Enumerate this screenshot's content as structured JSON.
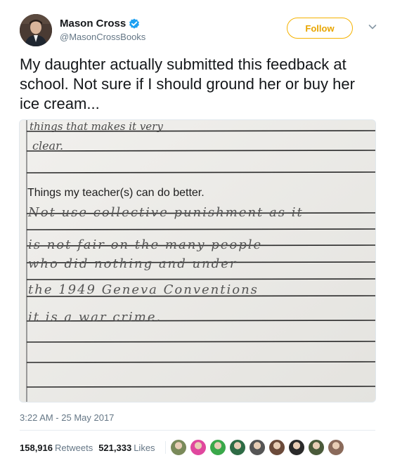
{
  "user": {
    "display_name": "Mason Cross",
    "handle": "@MasonCrossBooks"
  },
  "follow_button": {
    "label": "Follow"
  },
  "tweet": {
    "text": "My daughter actually submitted this feedback at school. Not sure if I should ground her or buy her ice cream...",
    "timestamp": "3:22 AM - 25 May 2017"
  },
  "photo": {
    "top_handwriting_1": "things that makes it very",
    "top_handwriting_2": "clear.",
    "prompt": "Things my teacher(s) can do better.",
    "lines": [
      "Not use collective punishment as it",
      "is not fair on the many people",
      "who did nothing and under",
      "the 1949 Geneva Conventions",
      "it is a war crime."
    ]
  },
  "stats": {
    "retweets_count": "158,916",
    "retweets_label": "Retweets",
    "likes_count": "521,333",
    "likes_label": "Likes"
  },
  "likers": [
    {
      "icon": "liker-avatar",
      "color": "#7a8a5a"
    },
    {
      "icon": "liker-avatar",
      "color": "#e0479e"
    },
    {
      "icon": "liker-avatar",
      "color": "#3aa84a"
    },
    {
      "icon": "liker-avatar",
      "color": "#2e6b45"
    },
    {
      "icon": "liker-avatar",
      "color": "#555555"
    },
    {
      "icon": "liker-avatar",
      "color": "#6b4a3a"
    },
    {
      "icon": "liker-avatar",
      "color": "#2a2a2a"
    },
    {
      "icon": "liker-avatar",
      "color": "#4a5a3a"
    },
    {
      "icon": "liker-avatar",
      "color": "#8a6a5a"
    }
  ],
  "colors": {
    "follow_accent": "#f5b200",
    "verified": "#1da1f2",
    "muted_text": "#657786"
  }
}
